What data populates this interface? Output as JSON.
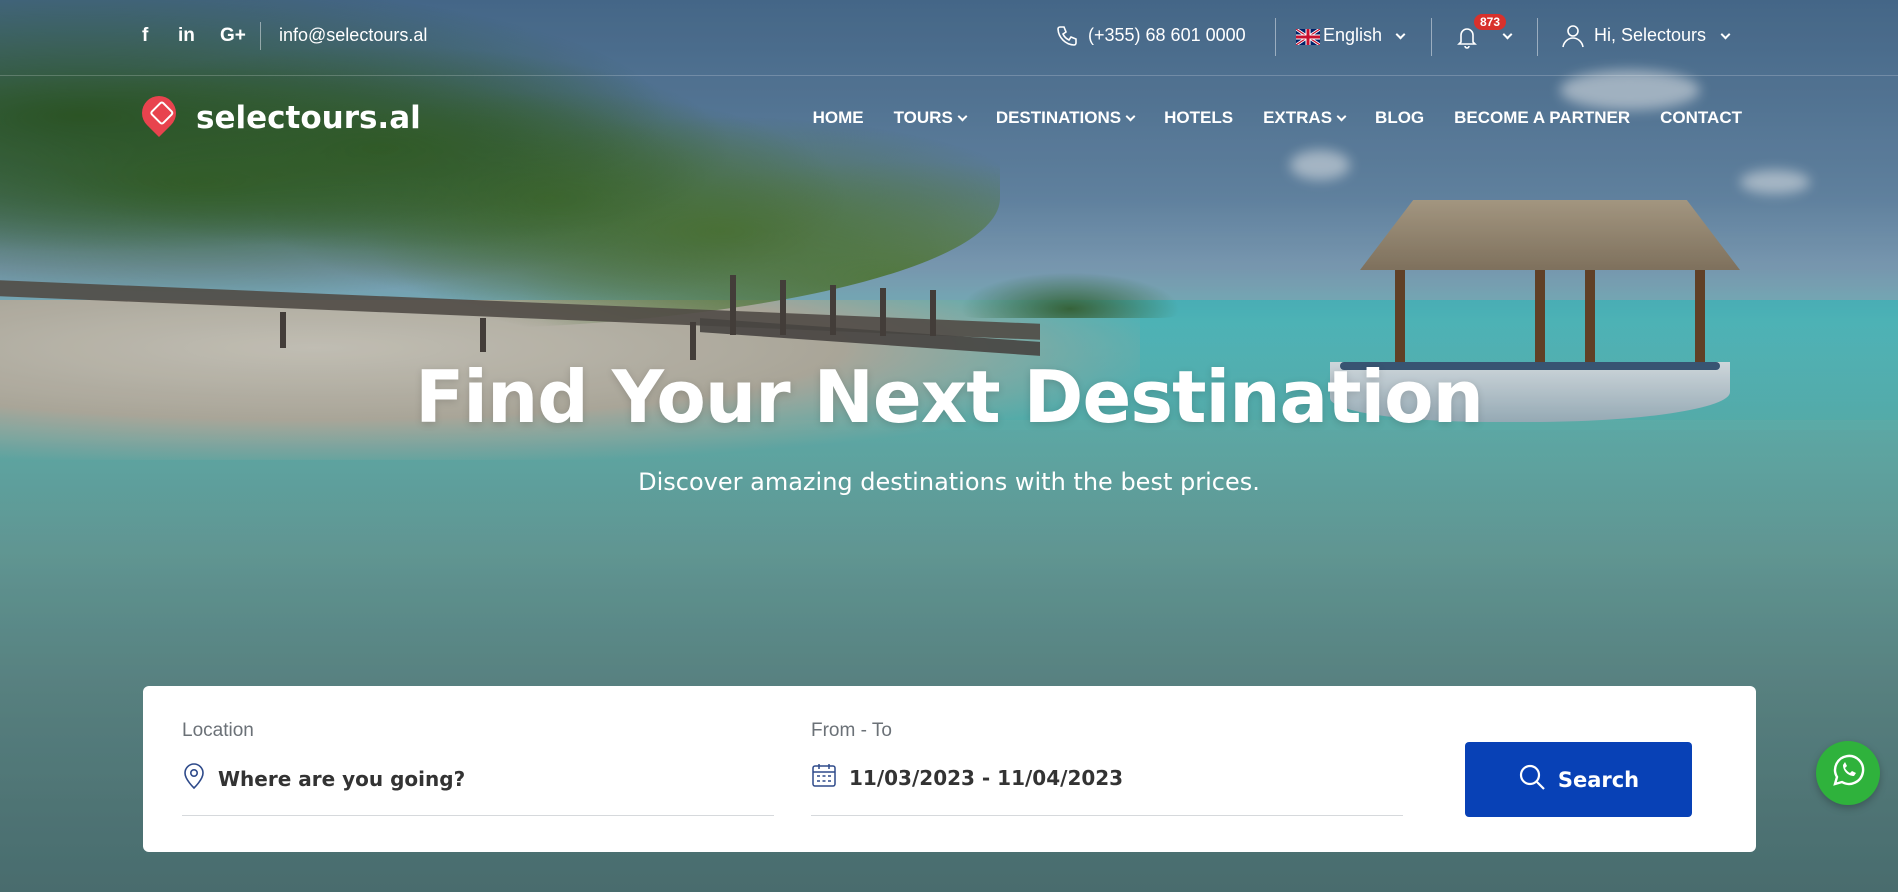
{
  "topbar": {
    "social": [
      "f",
      "in",
      "G+"
    ],
    "email": "info@selectours.al",
    "phone": "(+355) 68 601 0000",
    "language": "English",
    "notification_count": "873",
    "user_greeting": "Hi, Selectours"
  },
  "brand": {
    "name": "selectours.al",
    "accent": "#e8434e"
  },
  "nav": {
    "items": [
      {
        "label": "HOME"
      },
      {
        "label": "TOURS"
      },
      {
        "label": "DESTINATIONS"
      },
      {
        "label": "HOTELS"
      },
      {
        "label": "EXTRAS"
      },
      {
        "label": "BLOG"
      },
      {
        "label": "BECOME A PARTNER"
      },
      {
        "label": "CONTACT"
      }
    ]
  },
  "hero": {
    "title": "Find Your Next Destination",
    "subtitle": "Discover amazing destinations with the best prices."
  },
  "search": {
    "location_label": "Location",
    "location_placeholder": "Where are you going?",
    "dates_label": "From - To",
    "dates_value": "11/03/2023 - 11/04/2023",
    "button_label": "Search",
    "button_color": "#0841b6"
  },
  "colors": {
    "whatsapp": "#2fb23c",
    "badge": "#d8312c"
  }
}
